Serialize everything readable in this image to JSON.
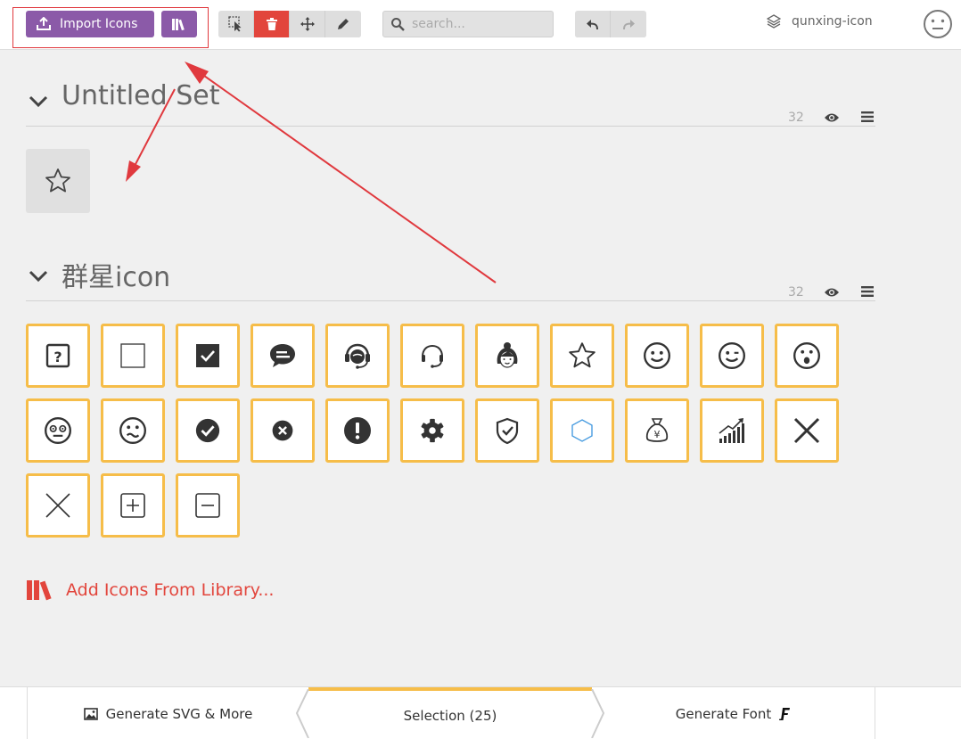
{
  "toolbar": {
    "import_label": "Import Icons",
    "search_placeholder": "search...",
    "project_name": "qunxing-icon"
  },
  "sets": [
    {
      "title": "Untitled Set",
      "count": "32"
    },
    {
      "title": "群星icon",
      "count": "32"
    }
  ],
  "icons": [
    "question-square-icon",
    "empty-square-icon",
    "checked-square-icon",
    "chat-bubble-icon",
    "customer-service-headset-icon",
    "headset-icon",
    "woman-avatar-icon",
    "star-outline-icon",
    "smile-icon",
    "wink-icon",
    "surprised-icon",
    "dizzy-face-icon",
    "sad-face-icon",
    "check-circle-icon",
    "close-circle-icon",
    "exclamation-circle-icon",
    "gear-icon",
    "shield-check-icon",
    "hexagon-icon",
    "money-bag-icon",
    "signal-growth-icon",
    "close-bold-icon",
    "close-thin-icon",
    "plus-square-icon",
    "minus-square-icon"
  ],
  "add_library_label": "Add Icons From Library...",
  "footer": {
    "generate_svg_label": "Generate SVG & More",
    "selection_label": "Selection (25)",
    "generate_font_label": "Generate Font"
  },
  "colors": {
    "accent_purple": "#8b5aa8",
    "danger_red": "#e2453c",
    "selection_orange": "#f6bd49",
    "annotation_red": "#e0393e"
  }
}
